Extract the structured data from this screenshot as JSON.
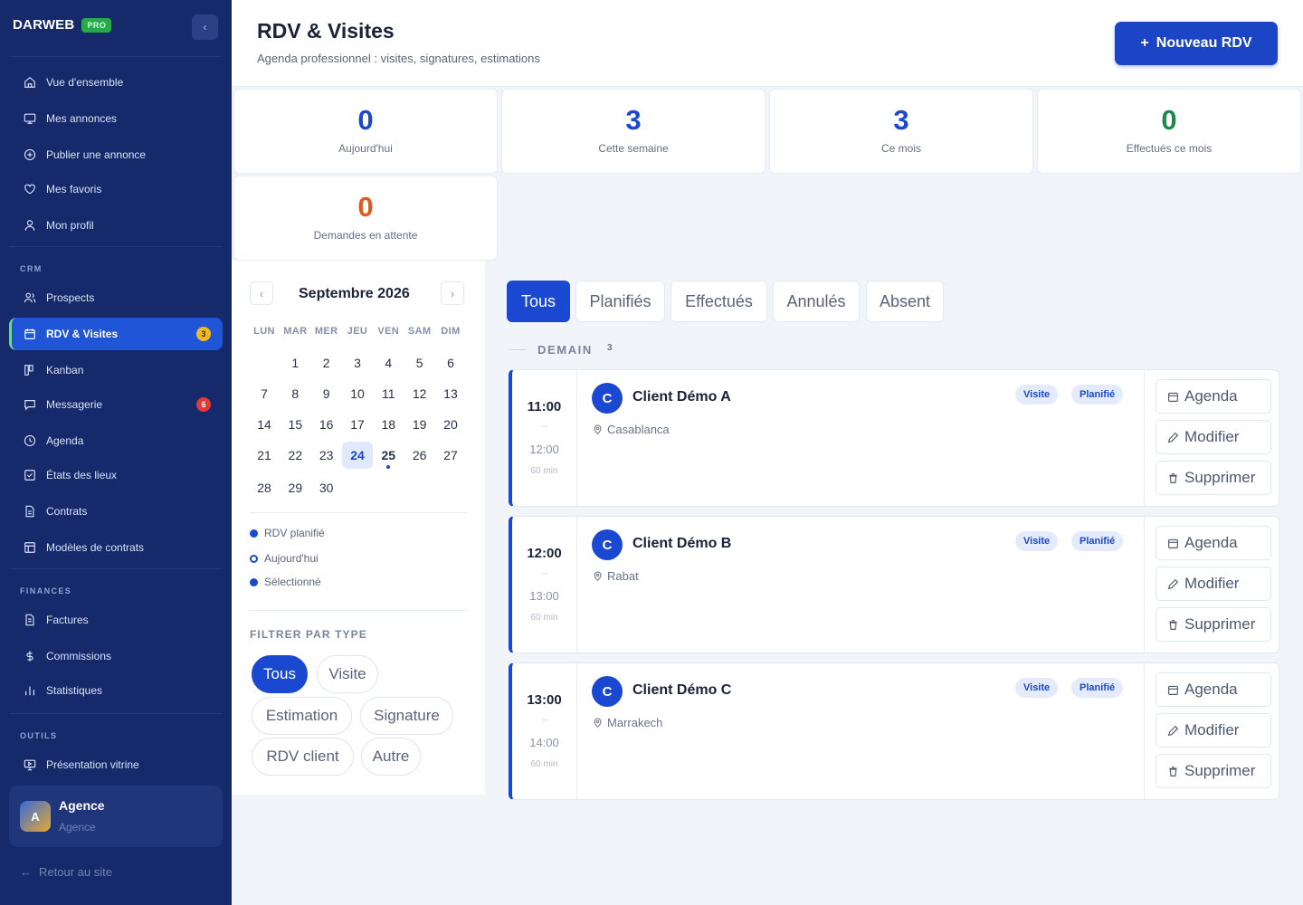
{
  "sidebar": {
    "brand": "DARWEB",
    "pro_badge": "PRO",
    "collapse_glyph": "‹",
    "main_items": [
      {
        "label": "Vue d'ensemble",
        "icon": "home-icon"
      },
      {
        "label": "Mes annonces",
        "icon": "monitor-icon"
      },
      {
        "label": "Publier une annonce",
        "icon": "plus-circle-icon"
      },
      {
        "label": "Mes favoris",
        "icon": "heart-icon"
      },
      {
        "label": "Mon profil",
        "icon": "user-icon"
      }
    ],
    "sections": {
      "crm": "CRM",
      "finances": "FINANCES",
      "outils": "OUTILS"
    },
    "crm_items": [
      {
        "label": "Prospects",
        "icon": "users-icon"
      },
      {
        "label": "RDV & Visites",
        "icon": "calendar-icon",
        "badge": "3"
      },
      {
        "label": "Kanban",
        "icon": "kanban-icon"
      },
      {
        "label": "Messagerie",
        "icon": "message-icon",
        "badge": "6"
      },
      {
        "label": "Agenda",
        "icon": "clock-icon"
      },
      {
        "label": "États des lieux",
        "icon": "checklist-icon"
      },
      {
        "label": "Contrats",
        "icon": "document-icon"
      },
      {
        "label": "Modèles de contrats",
        "icon": "template-icon"
      }
    ],
    "finance_items": [
      {
        "label": "Factures",
        "icon": "invoice-icon"
      },
      {
        "label": "Commissions",
        "icon": "dollar-icon"
      },
      {
        "label": "Statistiques",
        "icon": "bar-chart-icon"
      }
    ],
    "tool_items": [
      {
        "label": "Présentation vitrine",
        "icon": "presentation-icon"
      }
    ],
    "user": {
      "initial": "A",
      "name": "Agence",
      "role": "Agence"
    },
    "back_link": "Retour au site"
  },
  "header": {
    "title": "RDV & Visites",
    "subtitle": "Agenda professionnel : visites, signatures, estimations",
    "new_button": "Nouveau RDV",
    "new_button_glyph": "+"
  },
  "stats": [
    {
      "value": "0",
      "label": "Aujourd'hui",
      "color": "#1b48d0"
    },
    {
      "value": "3",
      "label": "Cette semaine",
      "color": "#1b48d0"
    },
    {
      "value": "3",
      "label": "Ce mois",
      "color": "#1b48d0"
    },
    {
      "value": "0",
      "label": "Effectués ce mois",
      "color": "#1a8a4a"
    },
    {
      "value": "0",
      "label": "Demandes en attente",
      "color": "#e0581f"
    }
  ],
  "calendar": {
    "prev_glyph": "‹",
    "next_glyph": "›",
    "month": "Septembre 2026",
    "weekdays": [
      "LUN",
      "MAR",
      "MER",
      "JEU",
      "VEN",
      "SAM",
      "DIM"
    ],
    "first_weekday_index": 1,
    "days_in_month": 30,
    "selected_day": 24,
    "today_day": 25,
    "legend": [
      {
        "label": "RDV planifié",
        "style": "dot"
      },
      {
        "label": "Aujourd'hui",
        "style": "ring"
      },
      {
        "label": "Sélectionné",
        "style": "dot"
      }
    ],
    "filter_title": "FILTRER PAR TYPE",
    "filter_chips": [
      "Tous",
      "Visite",
      "Estimation",
      "Signature",
      "RDV client",
      "Autre"
    ],
    "active_chip": "Tous"
  },
  "tabs": [
    "Tous",
    "Planifiés",
    "Effectués",
    "Annulés",
    "Absent"
  ],
  "active_tab": "Tous",
  "group": {
    "label": "DEMAIN",
    "count": "3"
  },
  "appointments": [
    {
      "start": "11:00",
      "arrow": "→",
      "end": "12:00",
      "duration": "60 min",
      "initial": "C",
      "client": "Client Démo A",
      "location": "Casablanca",
      "tags": [
        "Visite",
        "Planifié"
      ]
    },
    {
      "start": "12:00",
      "arrow": "→",
      "end": "13:00",
      "duration": "60 min",
      "initial": "C",
      "client": "Client Démo B",
      "location": "Rabat",
      "tags": [
        "Visite",
        "Planifié"
      ]
    },
    {
      "start": "13:00",
      "arrow": "→",
      "end": "14:00",
      "duration": "60 min",
      "initial": "C",
      "client": "Client Démo C",
      "location": "Marrakech",
      "tags": [
        "Visite",
        "Planifié"
      ]
    }
  ],
  "appointment_actions": [
    "Agenda",
    "Modifier",
    "Supprimer"
  ],
  "colors": {
    "sidebar_bg": "#15296b",
    "accent": "#1b48d0",
    "success": "#1a8a4a",
    "warning": "#e0581f"
  }
}
